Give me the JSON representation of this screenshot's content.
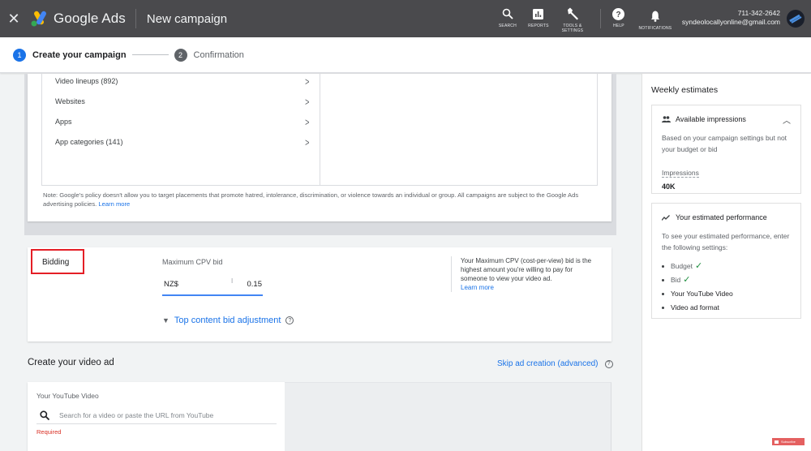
{
  "header": {
    "close_icon": "close-icon",
    "brand": "Google Ads",
    "page_title": "New campaign",
    "actions": [
      {
        "icon": "search-icon",
        "label": "SEARCH"
      },
      {
        "icon": "reports-icon",
        "label": "REPORTS"
      },
      {
        "icon": "wrench-icon",
        "label": "TOOLS & SETTINGS"
      },
      {
        "icon": "help-icon",
        "label": "HELP"
      },
      {
        "icon": "bell-icon",
        "label": "NOTIFICATIONS"
      }
    ],
    "account": {
      "phone": "711-342-2642",
      "email": "syndeolocallyonline@gmail.com"
    }
  },
  "stepper": {
    "steps": [
      {
        "number": "1",
        "label": "Create your campaign",
        "state": "active"
      },
      {
        "number": "2",
        "label": "Confirmation",
        "state": "inactive"
      }
    ]
  },
  "placements": {
    "items": [
      {
        "label": "Video lineups (892)"
      },
      {
        "label": "Websites"
      },
      {
        "label": "Apps"
      },
      {
        "label": "App categories (141)"
      }
    ],
    "note": "Note: Google's policy doesn't allow you to target placements that promote hatred, intolerance, discrimination, or violence towards an individual or group. All campaigns are subject to the Google Ads advertising policies.",
    "learn_more": "Learn more"
  },
  "bidding": {
    "section_label": "Bidding",
    "field_label": "Maximum CPV bid",
    "currency": "NZ$",
    "value": "0.15",
    "top_content_link": "Top content bid adjustment",
    "help_text": "Your Maximum CPV (cost-per-view) bid is the highest amount you're willing to pay for someone to view your video ad.",
    "learn_more": "Learn more"
  },
  "video_ad": {
    "heading": "Create your video ad",
    "skip_link": "Skip ad creation (advanced)",
    "yt_label": "Your YouTube Video",
    "search_placeholder": "Search for a video or paste the URL from YouTube",
    "search_value": "",
    "error": "Required"
  },
  "estimates": {
    "title": "Weekly estimates",
    "impressions_card": {
      "title": "Available impressions",
      "description": "Based on your campaign settings but not your budget or bid",
      "metric_label": "Impressions",
      "metric_value": "40K"
    },
    "performance_card": {
      "title": "Your estimated performance",
      "description": "To see your estimated performance, enter the following settings:",
      "items": [
        {
          "label": "Budget",
          "done": true
        },
        {
          "label": "Bid",
          "done": true
        },
        {
          "label": "Your YouTube Video",
          "done": false
        },
        {
          "label": "Video ad format",
          "done": false
        }
      ]
    }
  },
  "overlay": {
    "subscribe_label": "Subscribe"
  },
  "colors": {
    "accent": "#1a73e8",
    "highlight_box": "#e41e26",
    "error": "#d93025",
    "success": "#1e8e3e",
    "topbar": "#4a4a4d"
  }
}
